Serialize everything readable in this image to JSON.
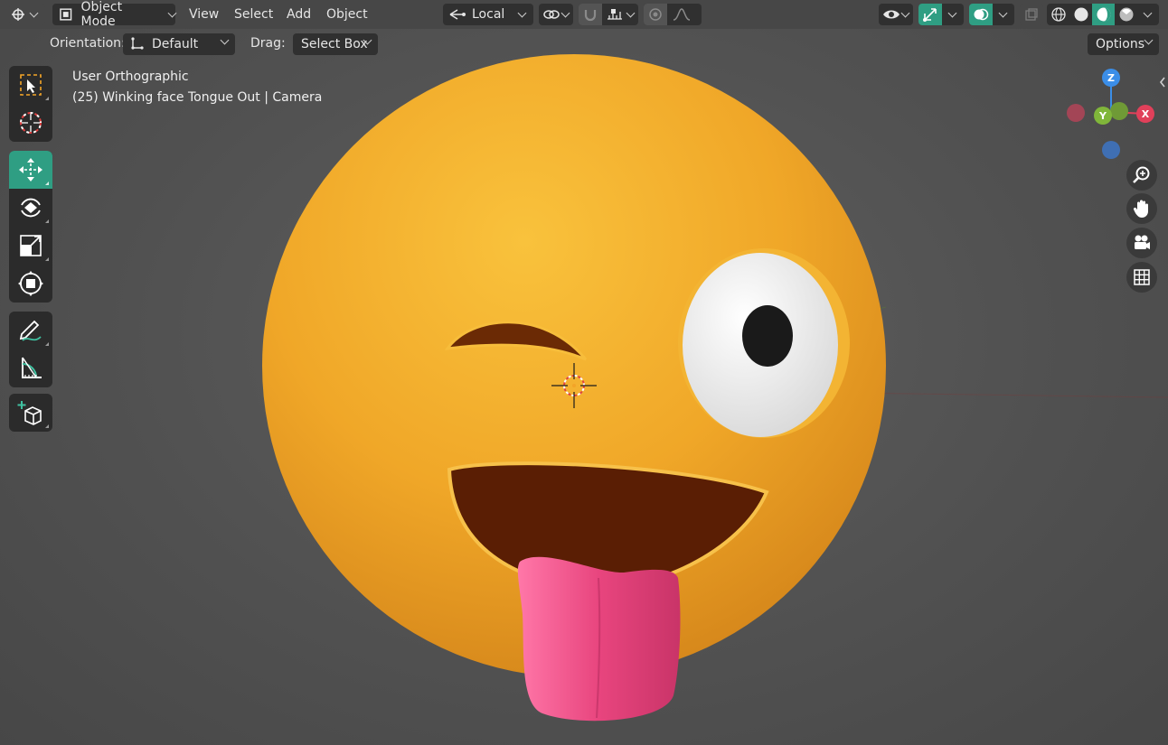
{
  "header": {
    "mode_label": "Object Mode",
    "menus": [
      "View",
      "Select",
      "Add",
      "Object"
    ],
    "transform_orientation": "Local"
  },
  "toolheader": {
    "orientation_label": "Orientation:",
    "orientation_value": "Default",
    "drag_label": "Drag:",
    "drag_value": "Select Box",
    "options_label": "Options"
  },
  "viewport": {
    "view_name": "User Orthographic",
    "object_info": "(25) Winking face Tongue Out | Camera"
  },
  "gizmo": {
    "axes": [
      "Z",
      "Y",
      "X"
    ],
    "colors": {
      "x": "#e0405a",
      "y": "#80b63a",
      "z": "#3b8ee8"
    }
  },
  "toolbar": {
    "tools": [
      "select-box",
      "cursor",
      "move",
      "rotate",
      "scale",
      "transform",
      "annotate",
      "measure",
      "add-cube"
    ],
    "active_tool": "move"
  },
  "colors": {
    "accent": "#2f9e83",
    "emoji_face": "#f0a728",
    "tongue": "#e8457e"
  }
}
